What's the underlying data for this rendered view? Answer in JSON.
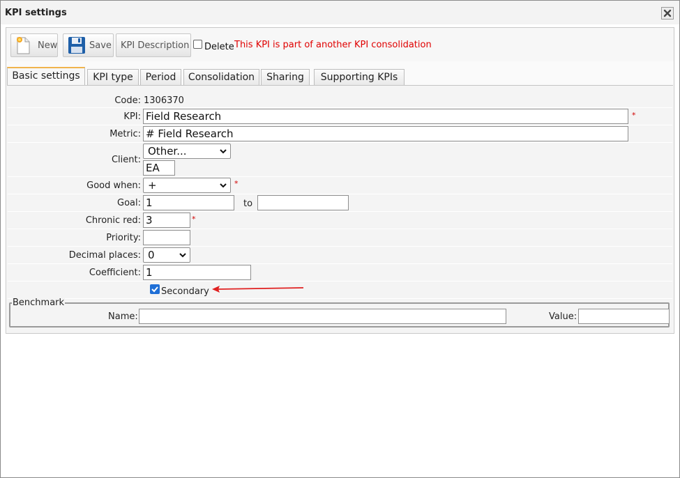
{
  "window": {
    "title": "KPI settings"
  },
  "toolbar": {
    "new_label": "New",
    "save_label": "Save",
    "description_label": "KPI Description",
    "delete_label": "Delete",
    "delete_checked": false,
    "warning": "This KPI is part of another KPI consolidation",
    "warning_color": "#e00000"
  },
  "tabs": [
    {
      "label": "Basic settings",
      "active": true
    },
    {
      "label": "KPI type"
    },
    {
      "label": "Period"
    },
    {
      "label": "Consolidation"
    },
    {
      "label": "Sharing"
    },
    {
      "label": "Supporting KPIs"
    }
  ],
  "form": {
    "code_label": "Code:",
    "code_value": "1306370",
    "kpi_label": "KPI:",
    "kpi_value": "Field Research",
    "metric_label": "Metric:",
    "metric_value": "# Field Research",
    "client_label": "Client:",
    "client_select": "Other...",
    "client_value": "EA",
    "good_when_label": "Good when:",
    "good_when_value": "+",
    "goal_label": "Goal:",
    "goal_value": "1",
    "goal_to_label": "to",
    "goal_to_value": "",
    "chronic_red_label": "Chronic red:",
    "chronic_red_value": "3",
    "priority_label": "Priority:",
    "priority_value": "",
    "decimal_label": "Decimal places:",
    "decimal_value": "0",
    "coefficient_label": "Coefficient:",
    "coefficient_value": "1",
    "secondary_label": "Secondary",
    "secondary_checked": true,
    "required_mark": "*"
  },
  "benchmark": {
    "legend": "Benchmark",
    "name_label": "Name:",
    "name_value": "",
    "value_label": "Value:",
    "value_value": ""
  },
  "colors": {
    "accent_tab": "#f0b44c",
    "annotation_arrow": "#e02020",
    "checkbox": "#1f6fd6"
  }
}
